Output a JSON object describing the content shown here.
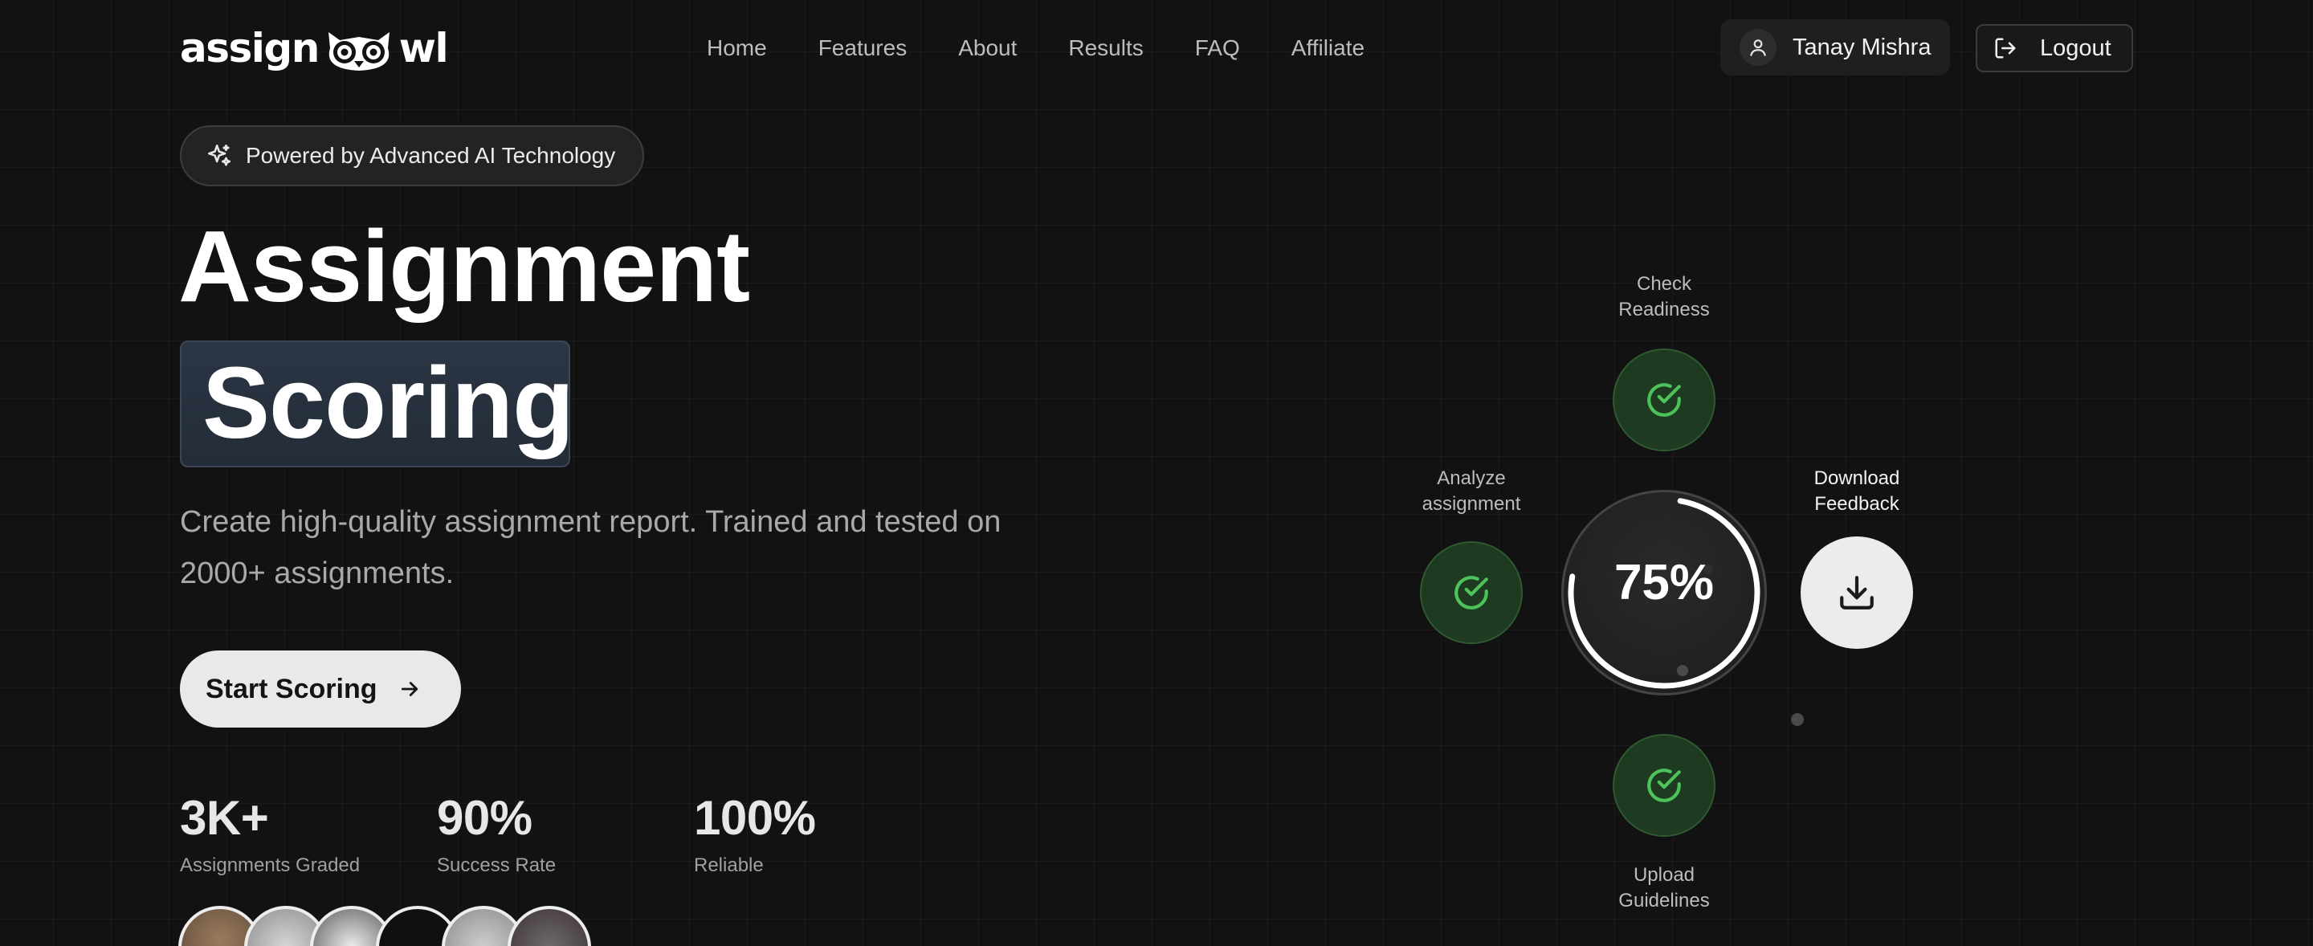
{
  "nav": {
    "logo_left": "assign",
    "logo_right": "wl",
    "links": [
      "Home",
      "Features",
      "About",
      "Results",
      "FAQ",
      "Affiliate"
    ],
    "user_name": "Tanay Mishra",
    "logout_label": "Logout"
  },
  "hero": {
    "badge": "Powered by Advanced AI Technology",
    "title_line1": "Assignment",
    "title_line2": "Scoring",
    "subtitle": "Create high-quality assignment report. Trained and tested on 2000+ assignments.",
    "cta_label": "Start Scoring",
    "stats": [
      {
        "value": "3K+",
        "label": "Assignments Graded"
      },
      {
        "value": "90%",
        "label": "Success Rate"
      },
      {
        "value": "100%",
        "label": "Reliable"
      }
    ]
  },
  "workflow": {
    "center_value": "75%",
    "progress_fraction": 0.75,
    "steps": {
      "top": {
        "line1": "Check",
        "line2": "Readiness"
      },
      "left": {
        "line1": "Analyze",
        "line2": "assignment"
      },
      "right": {
        "line1": "Download",
        "line2": "Feedback"
      },
      "bottom": {
        "line1": "Upload",
        "line2": "Guidelines"
      }
    }
  },
  "colors": {
    "background": "#121212",
    "accent_green": "#4cc25a",
    "scoring_highlight": "#2b3544"
  },
  "icons": [
    "user-icon",
    "logout-icon",
    "sparkles-icon",
    "arrow-right-icon",
    "check-circle-icon",
    "download-icon"
  ]
}
